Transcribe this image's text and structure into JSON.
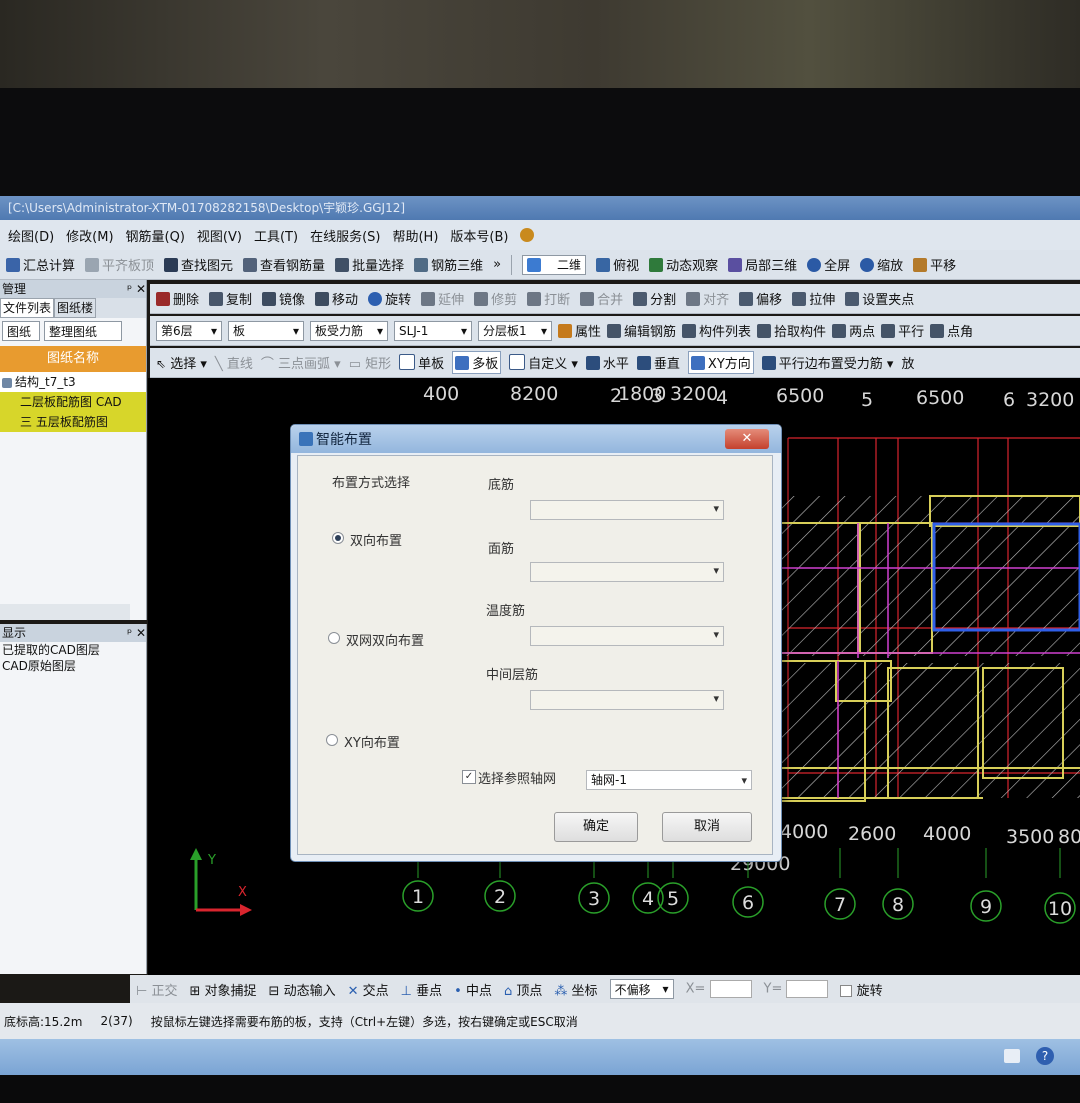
{
  "window": {
    "title": "[C:\\Users\\Administrator-XTM-01708282158\\Desktop\\宇颖珍.GGJ12]"
  },
  "menu": [
    "绘图(D)",
    "修改(M)",
    "钢筋量(Q)",
    "视图(V)",
    "工具(T)",
    "在线服务(S)",
    "帮助(H)",
    "版本号(B)"
  ],
  "toolbar1": {
    "items": [
      "汇总计算",
      "平齐板顶",
      "查找图元",
      "查看钢筋量",
      "批量选择",
      "钢筋三维"
    ],
    "view_mode": "二维",
    "view_items": [
      "俯视",
      "动态观察",
      "局部三维",
      "全屏",
      "缩放",
      "平移"
    ]
  },
  "toolbar2": [
    "删除",
    "复制",
    "镜像",
    "移动",
    "旋转",
    "延伸",
    "修剪",
    "打断",
    "合并",
    "分割",
    "对齐",
    "偏移",
    "拉伸",
    "设置夹点"
  ],
  "toolbar3": {
    "floor": "第6层",
    "category": "板",
    "type": "板受力筋",
    "name": "SLJ-1",
    "layer": "分层板1",
    "actions": [
      "属性",
      "编辑钢筋",
      "构件列表",
      "拾取构件",
      "两点",
      "平行",
      "点角"
    ]
  },
  "toolbar4": [
    "选择",
    "直线",
    "三点画弧",
    "矩形",
    "单板",
    "多板",
    "自定义",
    "水平",
    "垂直",
    "XY方向",
    "平行边布置受力筋",
    "放"
  ],
  "left_panel": {
    "header": "管理",
    "tabs": [
      "文件列表",
      "图纸楼"
    ],
    "buttons": [
      "图纸",
      "整理图纸"
    ],
    "column": "图纸名称",
    "rows": [
      "结构_t7_t3",
      "二层板配筋图 CAD",
      "三 五层板配筋图"
    ]
  },
  "display_panel": {
    "header": "显示",
    "items": [
      "已提取的CAD图层",
      "CAD原始图层"
    ]
  },
  "canvas": {
    "top_dims": [
      "400",
      "8200",
      "2",
      "1800",
      "3",
      "3200",
      "4",
      "6500",
      "5",
      "6500",
      "6",
      "3200"
    ],
    "bottom_dims": [
      "4000",
      "2600",
      "4000",
      "3500",
      "80"
    ],
    "extra_dim": "29000",
    "axis_numbers": [
      "1",
      "2",
      "3",
      "4",
      "5",
      "6",
      "7",
      "8",
      "9",
      "10"
    ],
    "ucs_x": "X",
    "ucs_y": "Y"
  },
  "dialog": {
    "title": "智能布置",
    "close": "✕",
    "section_label": "布置方式选择",
    "options": [
      "双向布置",
      "双网双向布置",
      "XY向布置"
    ],
    "selected": "双向布置",
    "fields": [
      "底筋",
      "面筋",
      "温度筋",
      "中间层筋"
    ],
    "checkbox_label": "选择参照轴网",
    "checkbox_checked": true,
    "grid_value": "轴网-1",
    "ok": "确定",
    "cancel": "取消"
  },
  "snapbar": [
    "正交",
    "对象捕捉",
    "动态输入",
    "交点",
    "垂点",
    "中点",
    "顶点",
    "坐标",
    "不偏移",
    "旋转"
  ],
  "statusbar": {
    "elevation": "底标高:15.2m",
    "count": "2(37)",
    "hint": "按鼠标左键选择需要布筋的板，支持（Ctrl+左键）多选，按右键确定或ESC取消"
  },
  "colors": {
    "grid_red": "#d9252e",
    "beam_yellow": "#d8cf59",
    "slab_white": "#c8c8c8",
    "magenta": "#d040d0",
    "selected_blue": "#2f5fe8",
    "axis_green": "#2aa02a"
  }
}
